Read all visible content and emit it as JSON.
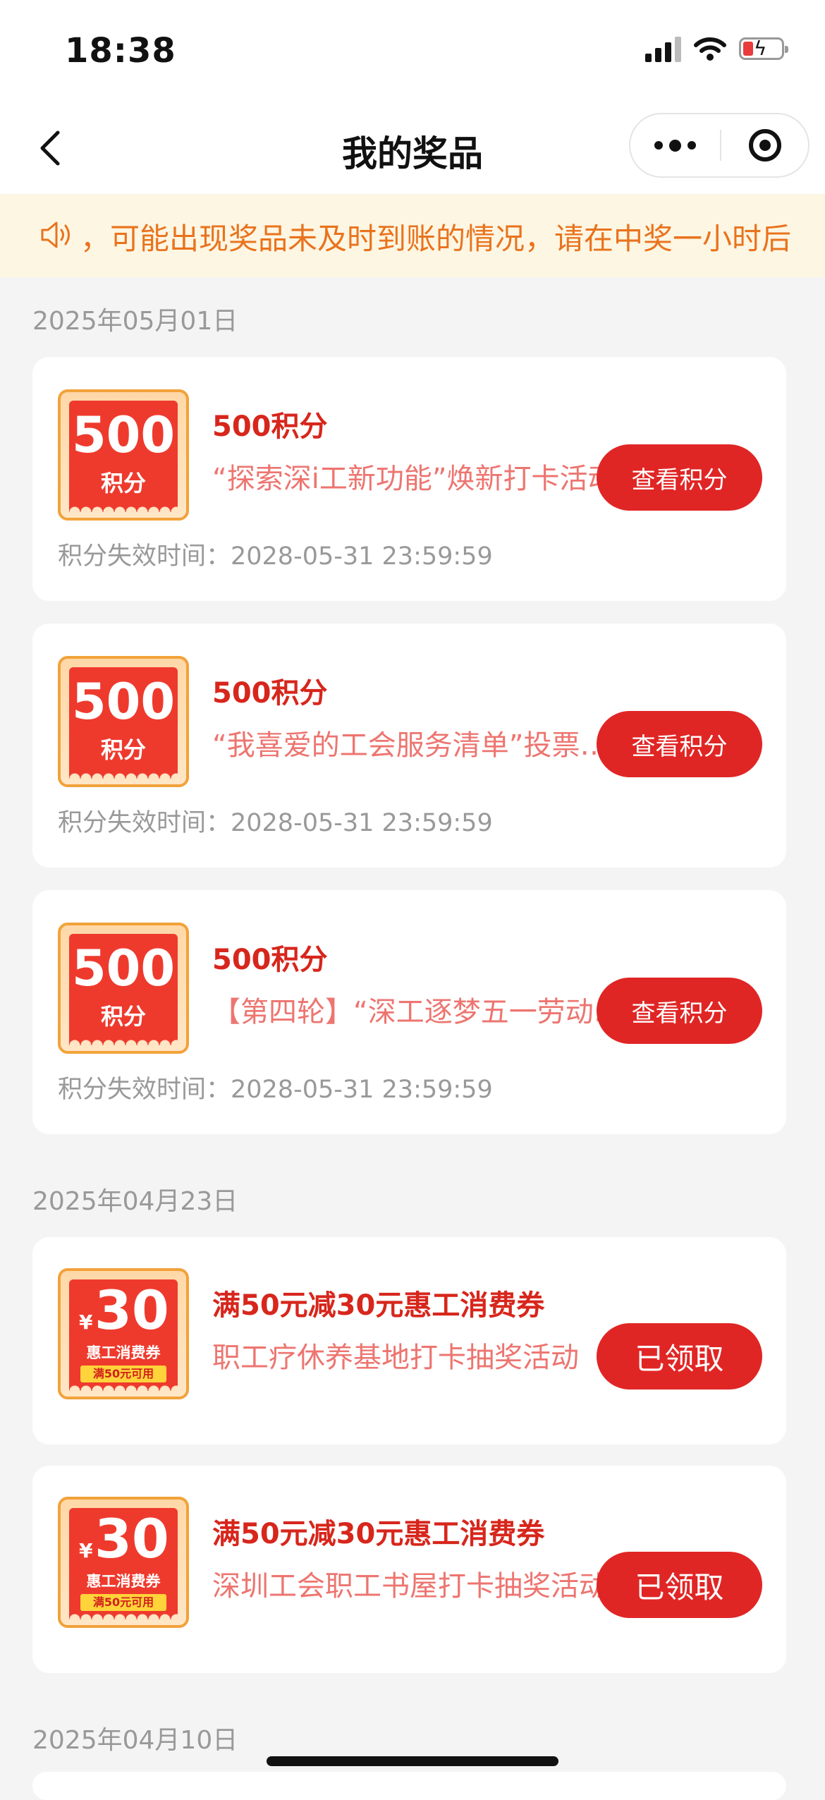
{
  "status_bar": {
    "time": "18:38"
  },
  "nav": {
    "title": "我的奖品"
  },
  "notice": {
    "text": "，可能出现奖品未及时到账的情况，请在中奖一小时后"
  },
  "groups": [
    {
      "date": "2025年05月01日",
      "items": [
        {
          "badge_num": "500",
          "badge_unit": "积分",
          "title": "500积分",
          "desc": "“探索深i工新功能”焕新打卡活动",
          "expiry": "积分失效时间：2028-05-31 23:59:59",
          "button": "查看积分"
        },
        {
          "badge_num": "500",
          "badge_unit": "积分",
          "title": "500积分",
          "desc": "“我喜爱的工会服务清单”投票活动",
          "expiry": "积分失效时间：2028-05-31 23:59:59",
          "button": "查看积分"
        },
        {
          "badge_num": "500",
          "badge_unit": "积分",
          "title": "500积分",
          "desc": "【第四轮】“深工逐梦五一劳动节”",
          "expiry": "积分失效时间：2028-05-31 23:59:59",
          "button": "查看积分"
        }
      ]
    },
    {
      "date": "2025年04月23日",
      "items": [
        {
          "coupon_yen": "¥",
          "coupon_amount": "30",
          "coupon_label": "惠工消费券",
          "coupon_cond": "满50元可用",
          "title": "满50元减30元惠工消费券",
          "desc": "职工疗休养基地打卡抽奖活动",
          "button": "已领取"
        },
        {
          "coupon_yen": "¥",
          "coupon_amount": "30",
          "coupon_label": "惠工消费券",
          "coupon_cond": "满50元可用",
          "title": "满50元减30元惠工消费券",
          "desc": "深圳工会职工书屋打卡抽奖活动",
          "button": "已领取"
        }
      ]
    },
    {
      "date": "2025年04月10日"
    }
  ],
  "colors": {
    "accent": "#e02625",
    "title_red": "#d7261c",
    "notice_bg": "#fdf6e3",
    "notice_text": "#e9731d"
  }
}
